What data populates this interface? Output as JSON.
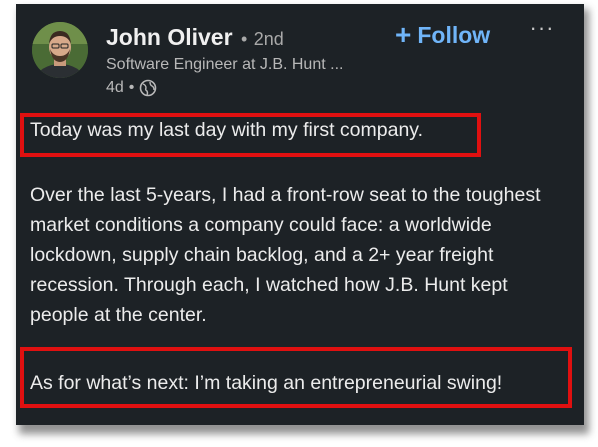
{
  "author": {
    "name": "John Oliver",
    "separator": "•",
    "degree": "2nd",
    "headline": "Software Engineer at J.B. Hunt ...",
    "time_ago": "4d",
    "meta_separator": "•",
    "visibility_icon": "globe-icon"
  },
  "actions": {
    "follow_plus": "+",
    "follow_label": "Follow",
    "more_label": "···"
  },
  "post": {
    "paragraph_1": "Today was my last day with my first company.",
    "paragraph_2": "Over the last 5-years, I had a front-row seat to the toughest market conditions a company could face: a worldwide lockdown, supply chain backlog, and a 2+ year freight recession. Through each, I watched how J.B. Hunt kept people at the center.",
    "paragraph_3": "As for what’s next: I’m taking an entrepreneurial swing!"
  },
  "colors": {
    "card_background": "#1d2226",
    "follow_blue": "#70b5f9",
    "highlight_red": "#e01010"
  }
}
